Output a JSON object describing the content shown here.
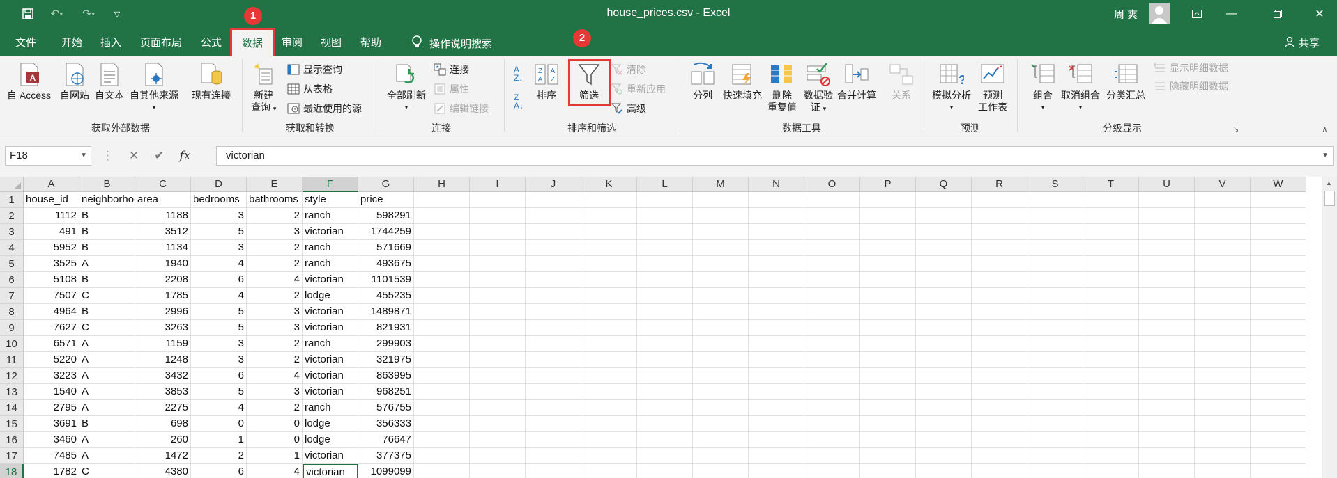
{
  "window": {
    "title": "house_prices.csv  -  Excel",
    "user": "周 爽"
  },
  "tabs": [
    "文件",
    "开始",
    "插入",
    "页面布局",
    "公式",
    "数据",
    "审阅",
    "视图",
    "帮助"
  ],
  "active_tab": "数据",
  "search_label": "操作说明搜索",
  "share_label": "共享",
  "annotations": {
    "step1": "1",
    "step2": "2"
  },
  "ribbon": {
    "groups": {
      "external": "获取外部数据",
      "transform": "获取和转换",
      "connections": "连接",
      "sortfilter": "排序和筛选",
      "datatools": "数据工具",
      "forecast": "预测",
      "outline": "分级显示"
    },
    "btn": {
      "access": "自 Access",
      "web": "自网站",
      "text": "自文本",
      "other1": "自其他来源",
      "existing": "现有连接",
      "newq1": "新建",
      "newq2": "查询",
      "showq": "显示查询",
      "fromtable": "从表格",
      "recent": "最近使用的源",
      "refresh": "全部刷新",
      "conn": "连接",
      "props": "属性",
      "editlinks": "编辑链接",
      "sort": "排序",
      "filter": "筛选",
      "clear": "清除",
      "reapply": "重新应用",
      "advanced": "高级",
      "split": "分列",
      "flash": "快速填充",
      "dedup1": "删除",
      "dedup2": "重复值",
      "valid1": "数据验",
      "valid2": "证",
      "consol": "合并计算",
      "relations": "关系",
      "whatif": "模拟分析",
      "fsheet1": "预测",
      "fsheet2": "工作表",
      "group": "组合",
      "ungroup": "取消组合",
      "subtotal": "分类汇总",
      "showdetail": "显示明细数据",
      "hidedetail": "隐藏明细数据"
    }
  },
  "namebox": "F18",
  "formula": "victorian",
  "columns": [
    "A",
    "B",
    "C",
    "D",
    "E",
    "F",
    "G",
    "H",
    "I",
    "J",
    "K",
    "L",
    "M",
    "N",
    "O",
    "P",
    "Q",
    "R",
    "S",
    "T",
    "U",
    "V",
    "W"
  ],
  "selected_col": "F",
  "header_row": [
    "house_id",
    "neighborhood",
    "area",
    "bedrooms",
    "bathrooms",
    "style",
    "price"
  ],
  "rows": [
    [
      "1112",
      "B",
      "1188",
      "3",
      "2",
      "ranch",
      "598291"
    ],
    [
      "491",
      "B",
      "3512",
      "5",
      "3",
      "victorian",
      "1744259"
    ],
    [
      "5952",
      "B",
      "1134",
      "3",
      "2",
      "ranch",
      "571669"
    ],
    [
      "3525",
      "A",
      "1940",
      "4",
      "2",
      "ranch",
      "493675"
    ],
    [
      "5108",
      "B",
      "2208",
      "6",
      "4",
      "victorian",
      "1101539"
    ],
    [
      "7507",
      "C",
      "1785",
      "4",
      "2",
      "lodge",
      "455235"
    ],
    [
      "4964",
      "B",
      "2996",
      "5",
      "3",
      "victorian",
      "1489871"
    ],
    [
      "7627",
      "C",
      "3263",
      "5",
      "3",
      "victorian",
      "821931"
    ],
    [
      "6571",
      "A",
      "1159",
      "3",
      "2",
      "ranch",
      "299903"
    ],
    [
      "5220",
      "A",
      "1248",
      "3",
      "2",
      "victorian",
      "321975"
    ],
    [
      "3223",
      "A",
      "3432",
      "6",
      "4",
      "victorian",
      "863995"
    ],
    [
      "1540",
      "A",
      "3853",
      "5",
      "3",
      "victorian",
      "968251"
    ],
    [
      "2795",
      "A",
      "2275",
      "4",
      "2",
      "ranch",
      "576755"
    ],
    [
      "3691",
      "B",
      "698",
      "0",
      "0",
      "lodge",
      "356333"
    ],
    [
      "3460",
      "A",
      "260",
      "1",
      "0",
      "lodge",
      "76647"
    ],
    [
      "7485",
      "A",
      "1472",
      "2",
      "1",
      "victorian",
      "377375"
    ],
    [
      "1782",
      "C",
      "4380",
      "6",
      "4",
      "victorian",
      "1099099"
    ]
  ],
  "active_cell": {
    "row": 18,
    "col": "F"
  }
}
